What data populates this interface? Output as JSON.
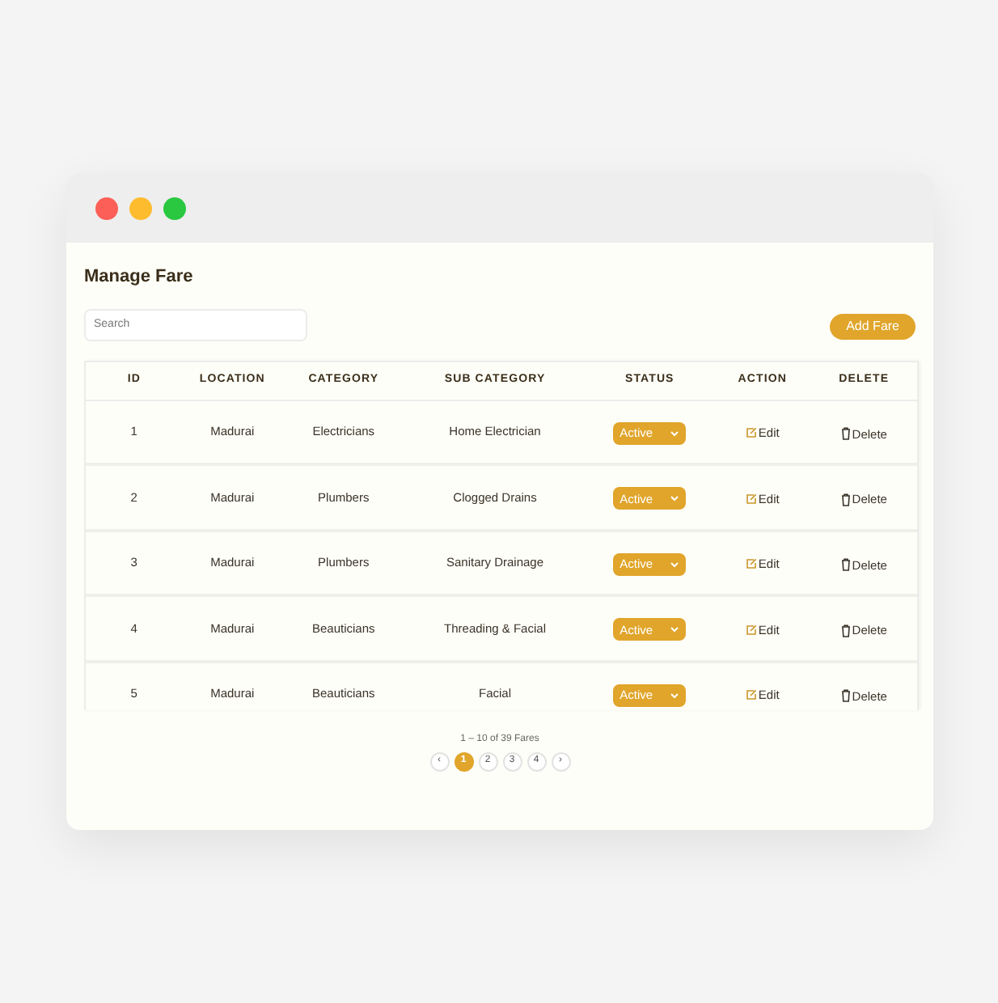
{
  "page": {
    "title": "Manage Fare"
  },
  "search": {
    "placeholder": "Search"
  },
  "add_button": "Add Fare",
  "table": {
    "columns": [
      "ID",
      "LOCATION",
      "CATEGORY",
      "SUB CATEGORY",
      "STATUS",
      "ACTION",
      "DELETE"
    ],
    "rows": [
      {
        "id": "1",
        "location": "Madurai",
        "category": "Electricians",
        "sub_category": "Home Electrician",
        "status": "Active",
        "action": "Edit",
        "delete": "Delete"
      },
      {
        "id": "2",
        "location": "Madurai",
        "category": "Plumbers",
        "sub_category": "Clogged Drains",
        "status": "Active",
        "action": "Edit",
        "delete": "Delete"
      },
      {
        "id": "3",
        "location": "Madurai",
        "category": "Plumbers",
        "sub_category": "Sanitary Drainage",
        "status": "Active",
        "action": "Edit",
        "delete": "Delete"
      },
      {
        "id": "4",
        "location": "Madurai",
        "category": "Beauticians",
        "sub_category": "Threading & Facial",
        "status": "Active",
        "action": "Edit",
        "delete": "Delete"
      },
      {
        "id": "5",
        "location": "Madurai",
        "category": "Beauticians",
        "sub_category": "Facial",
        "status": "Active",
        "action": "Edit",
        "delete": "Delete"
      }
    ]
  },
  "pagination": {
    "summary": "1 – 10 of 39 Fares",
    "prev": "‹",
    "next": "›",
    "pages": [
      {
        "label": "1",
        "selected": true
      },
      {
        "label": "2",
        "selected": false
      },
      {
        "label": "3",
        "selected": false
      },
      {
        "label": "4",
        "selected": false
      }
    ]
  }
}
